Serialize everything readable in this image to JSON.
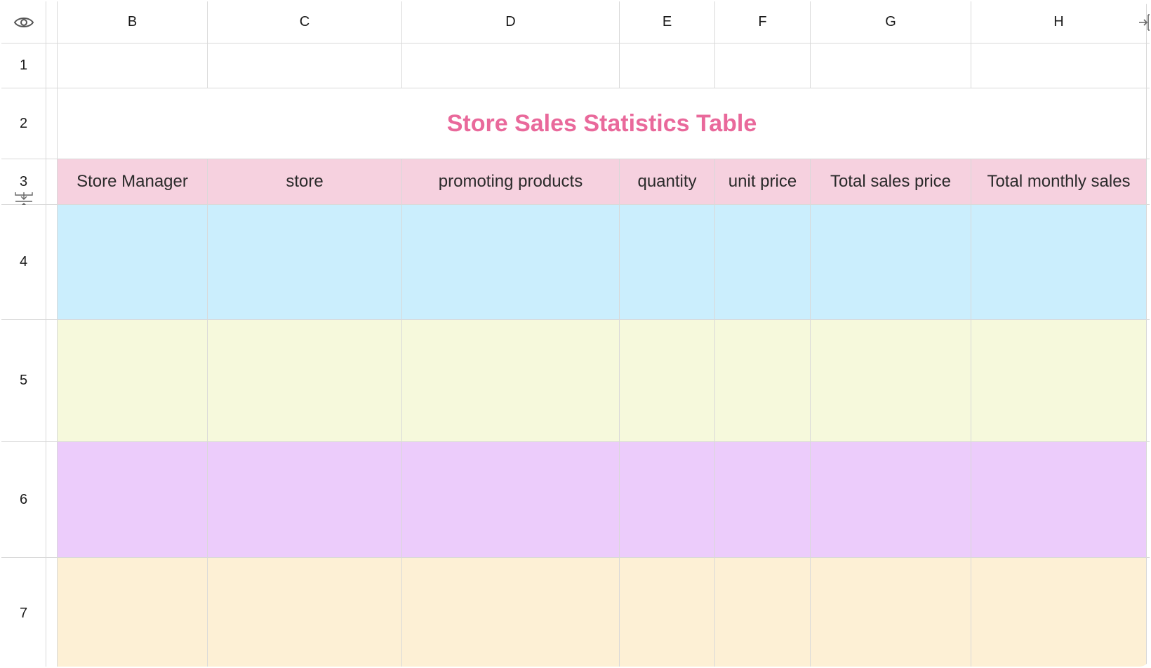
{
  "column_headers": [
    "B",
    "C",
    "D",
    "E",
    "F",
    "G",
    "H"
  ],
  "row_headers": [
    "1",
    "2",
    "3",
    "4",
    "5",
    "6",
    "7"
  ],
  "title": "Store Sales Statistics Table",
  "table_headers": [
    "Store Manager",
    "store",
    "promoting products",
    "quantity",
    "unit price",
    "Total sales price",
    "Total monthly sales"
  ],
  "colors": {
    "title": "#e9699b",
    "header_fill": "#f6d1df",
    "row4_fill": "#cbeefd",
    "row5_fill": "#f6f9dc",
    "row6_fill": "#ecccfb",
    "row7_fill": "#fdf0d5"
  },
  "icons": {
    "corner": "eye-icon",
    "freeze_column": "freeze-column-icon",
    "freeze_row": "freeze-row-icon"
  }
}
